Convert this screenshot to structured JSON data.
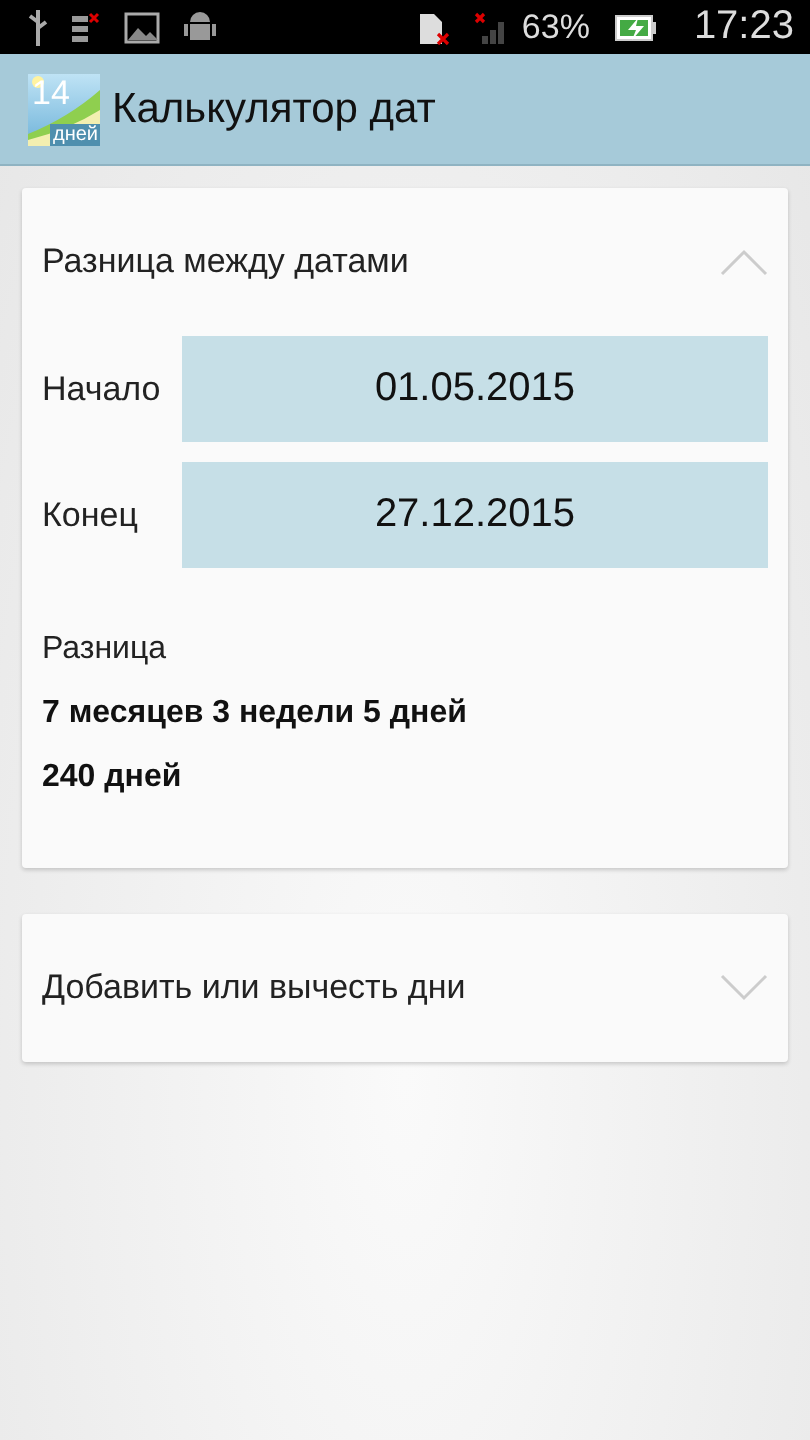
{
  "status_bar": {
    "battery": "63%",
    "time": "17:23"
  },
  "action_bar": {
    "app_icon": {
      "number": "14",
      "unit": "дней"
    },
    "title": "Калькулятор дат"
  },
  "sections": [
    {
      "title": "Разница между датами",
      "expanded": true,
      "fields": [
        {
          "label": "Начало",
          "value": "01.05.2015"
        },
        {
          "label": "Конец",
          "value": "27.12.2015"
        }
      ],
      "result_label": "Разница",
      "results": [
        "7 месяцев 3 недели 5 дней",
        "240 дней"
      ]
    },
    {
      "title": "Добавить или вычесть дни",
      "expanded": false
    }
  ]
}
